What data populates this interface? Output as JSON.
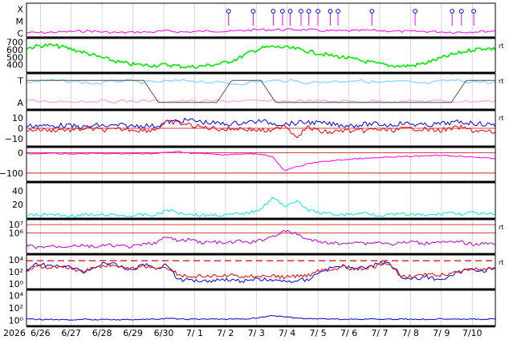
{
  "chart_data": {
    "type": "line",
    "year_label": "2026",
    "x_tick_labels": [
      "6/26",
      "6/27",
      "6/28",
      "6/29",
      "6/30",
      "7/ 1",
      "7/ 2",
      "7/ 3",
      "7/ 4",
      "7/ 5",
      "7/ 6",
      "7/ 7",
      "7/ 8",
      "7/ 9",
      "7/10"
    ],
    "x_range_days": [
      0,
      15.2
    ],
    "right_marker": "rt",
    "colors": {
      "magenta": "#ff00ff",
      "green": "#00ee00",
      "light_blue": "#99ddff",
      "pink": "#ffaaee",
      "gray": "#555555",
      "blue": "#0000ee",
      "red": "#ee0000",
      "purple": "#b000d0",
      "cyan": "#00eeee",
      "dark_blue": "#0000cc",
      "grid": "#bbbbbb"
    },
    "panels": [
      {
        "id": "xray",
        "tick_labels": [
          "X",
          "M",
          "C"
        ],
        "tick_values": [
          2,
          1,
          0
        ],
        "ylim": [
          -0.3,
          2.5
        ],
        "series": [
          {
            "color": "magenta",
            "values": [
              0.05,
              0.05,
              0.1,
              0.15,
              0.2,
              0.1,
              0.05,
              0.1,
              0.1,
              0.2,
              0.1,
              0.15,
              0.2,
              0.15,
              0.25,
              0.3,
              0.3,
              0.3,
              0.3,
              0.2,
              0.2,
              0.2,
              0.25,
              0.2,
              0.15,
              0.15,
              0.15,
              0.1,
              0.1,
              0.15,
              0.2
            ]
          }
        ],
        "flare_days": [
          6.55,
          7.35,
          8.0,
          8.3,
          8.55,
          8.9,
          9.15,
          9.45,
          9.85,
          10.1,
          11.2,
          12.6,
          13.8,
          14.1,
          14.5
        ]
      },
      {
        "id": "solar_wind_speed",
        "tick_labels": [
          "700",
          "600",
          "500",
          "400"
        ],
        "tick_values": [
          700,
          600,
          500,
          400
        ],
        "ylim": [
          300,
          750
        ],
        "series": [
          {
            "color": "green",
            "values": [
              620,
              650,
              660,
              640,
              600,
              560,
              510,
              470,
              430,
              405,
              395,
              390,
              400,
              380,
              370,
              380,
              400,
              430,
              480,
              560,
              620,
              640,
              630,
              610,
              580,
              550,
              520,
              500,
              470,
              440,
              410,
              390,
              380,
              390,
              420,
              470,
              520,
              560,
              600,
              620,
              610
            ]
          }
        ]
      },
      {
        "id": "imf_sector",
        "tick_labels": [
          "T",
          "A"
        ],
        "tick_values": [
          1,
          0
        ],
        "ylim": [
          -0.3,
          1.3
        ],
        "series": [
          {
            "color": "light_blue",
            "values": [
              0.9,
              1.0,
              0.95,
              0.85,
              1.0,
              0.9,
              0.95,
              1.0,
              0.9,
              0.85,
              0.95,
              1.0,
              0.9,
              0.95,
              1.0,
              0.9,
              0.95,
              0.85,
              1.0,
              0.95,
              0.9
            ]
          },
          {
            "color": "gray",
            "values": [
              1,
              1,
              1,
              1,
              1,
              1,
              1,
              1,
              1,
              0,
              0,
              0,
              0,
              0,
              1,
              1,
              1,
              0,
              0,
              0,
              0,
              0,
              0,
              0,
              0,
              0,
              0,
              0,
              0,
              0,
              1,
              1,
              1
            ]
          }
        ]
      },
      {
        "id": "imf_components",
        "tick_labels": [
          "10",
          "0",
          "−10"
        ],
        "tick_values": [
          10,
          0,
          -10
        ],
        "ylim": [
          -17,
          17
        ],
        "series": [
          {
            "color": "blue",
            "values": [
              2,
              3,
              2,
              3,
              2,
              1,
              3,
              2,
              3,
              2,
              3,
              2,
              6,
              7,
              8,
              6,
              5,
              4,
              5,
              6,
              7,
              5,
              4,
              5,
              6,
              5,
              4,
              3,
              3,
              4,
              4,
              3,
              5,
              4,
              3,
              4,
              5,
              6,
              5,
              4,
              3
            ]
          },
          {
            "color": "red",
            "values": [
              -2,
              -1,
              -2,
              -1,
              -2,
              0,
              -1,
              -2,
              -1,
              -1,
              -2,
              -1,
              6,
              5,
              3,
              1,
              0,
              -1,
              0,
              -1,
              -2,
              -3,
              4,
              -8,
              1,
              -3,
              -4,
              -2,
              -3,
              -2,
              -1,
              -2,
              -1,
              0,
              -1,
              -2,
              -1,
              1,
              -2,
              -3,
              -4
            ]
          }
        ]
      },
      {
        "id": "dst",
        "tick_labels": [
          "0",
          "−100"
        ],
        "tick_values": [
          0,
          -100
        ],
        "ylim": [
          -140,
          25
        ],
        "series": [
          {
            "color": "magenta",
            "values": [
              -5,
              -5,
              -4,
              -5,
              -6,
              -5,
              -4,
              -5,
              -6,
              -5,
              -4,
              -5,
              2,
              5,
              -2,
              -5,
              -8,
              -10,
              -8,
              -6,
              -7,
              -20,
              -90,
              -70,
              -55,
              -45,
              -40,
              -35,
              -30,
              -28,
              -25,
              -22,
              -20,
              -18,
              -15,
              -12,
              -15,
              -18,
              -20,
              -25,
              -30
            ]
          }
        ]
      },
      {
        "id": "proton_density",
        "tick_labels": [
          "40",
          "20"
        ],
        "tick_values": [
          40,
          20
        ],
        "ylim": [
          0,
          52
        ],
        "series": [
          {
            "color": "cyan",
            "values": [
              5,
              4,
              6,
              4,
              3,
              5,
              4,
              5,
              4,
              3,
              5,
              4,
              12,
              8,
              6,
              4,
              5,
              4,
              6,
              8,
              14,
              30,
              18,
              25,
              12,
              8,
              6,
              5,
              6,
              8,
              4,
              5,
              6,
              5,
              4,
              5,
              9,
              6,
              8,
              6,
              5
            ]
          }
        ]
      },
      {
        "id": "proton_flux",
        "tick_labels": [
          "10⁷",
          "10⁶"
        ],
        "tick_values": [
          7,
          6
        ],
        "ylim": [
          3.5,
          7.6
        ],
        "series": [
          {
            "color": "purple",
            "values": [
              4.5,
              4.2,
              4.4,
              4.3,
              4.5,
              4.4,
              4.3,
              4.5,
              4.4,
              4.3,
              4.6,
              4.8,
              5.5,
              5.0,
              5.2,
              4.8,
              4.9,
              4.7,
              5.0,
              4.8,
              5.1,
              5.6,
              6.2,
              5.9,
              5.2,
              4.9,
              4.8,
              4.6,
              5.0,
              4.7,
              4.9,
              4.6,
              4.8,
              4.9,
              4.7,
              5.0,
              4.8,
              4.9,
              4.6,
              4.7,
              4.8
            ]
          }
        ]
      },
      {
        "id": "electron_flux",
        "tick_labels": [
          "10⁴",
          "10²",
          "10⁰"
        ],
        "tick_values": [
          4,
          2,
          0
        ],
        "ylim": [
          -0.8,
          4.8
        ],
        "threshold": 3.85,
        "series": [
          {
            "color": "blue",
            "values": [
              2.2,
              3.4,
              2.8,
              3.2,
              2.5,
              2.0,
              3.0,
              3.5,
              2.8,
              2.4,
              3.3,
              2.6,
              3.2,
              0.6,
              0.7,
              0.5,
              0.6,
              0.8,
              0.5,
              0.6,
              0.8,
              0.6,
              0.4,
              0.5,
              0.7,
              2.0,
              2.6,
              3.0,
              2.4,
              2.8,
              3.4,
              3.6,
              1.0,
              0.8,
              1.2,
              0.8,
              1.0,
              2.0,
              2.5,
              2.2,
              2.8
            ]
          },
          {
            "color": "red",
            "values": [
              2.0,
              3.0,
              2.6,
              3.0,
              2.4,
              2.2,
              2.8,
              3.2,
              2.6,
              2.5,
              3.0,
              2.6,
              2.8,
              1.5,
              1.2,
              1.3,
              1.2,
              1.4,
              1.3,
              1.2,
              1.4,
              1.3,
              1.1,
              1.3,
              1.4,
              2.2,
              2.5,
              2.8,
              2.4,
              2.6,
              3.0,
              3.2,
              1.4,
              1.3,
              1.5,
              1.4,
              1.6,
              2.2,
              2.5,
              2.3,
              2.6
            ]
          }
        ]
      },
      {
        "id": "xray_background",
        "tick_labels": [
          "10⁴",
          "10²",
          "10⁰"
        ],
        "tick_values": [
          4,
          2,
          0
        ],
        "ylim": [
          -0.8,
          4.8
        ],
        "series": [
          {
            "color": "dark_blue",
            "values": [
              0.2,
              0.15,
              0.2,
              0.1,
              0.15,
              0.2,
              0.15,
              0.2,
              0.1,
              0.15,
              0.2,
              0.2,
              0.3,
              0.25,
              0.2,
              0.2,
              0.25,
              0.2,
              0.2,
              0.3,
              0.5,
              0.8,
              0.6,
              0.4,
              0.3,
              0.3,
              0.25,
              0.2,
              0.2,
              0.25,
              0.2,
              0.2,
              0.25,
              0.2,
              0.2,
              0.25,
              0.3,
              0.25,
              0.2,
              0.2,
              0.25
            ]
          }
        ]
      }
    ]
  }
}
